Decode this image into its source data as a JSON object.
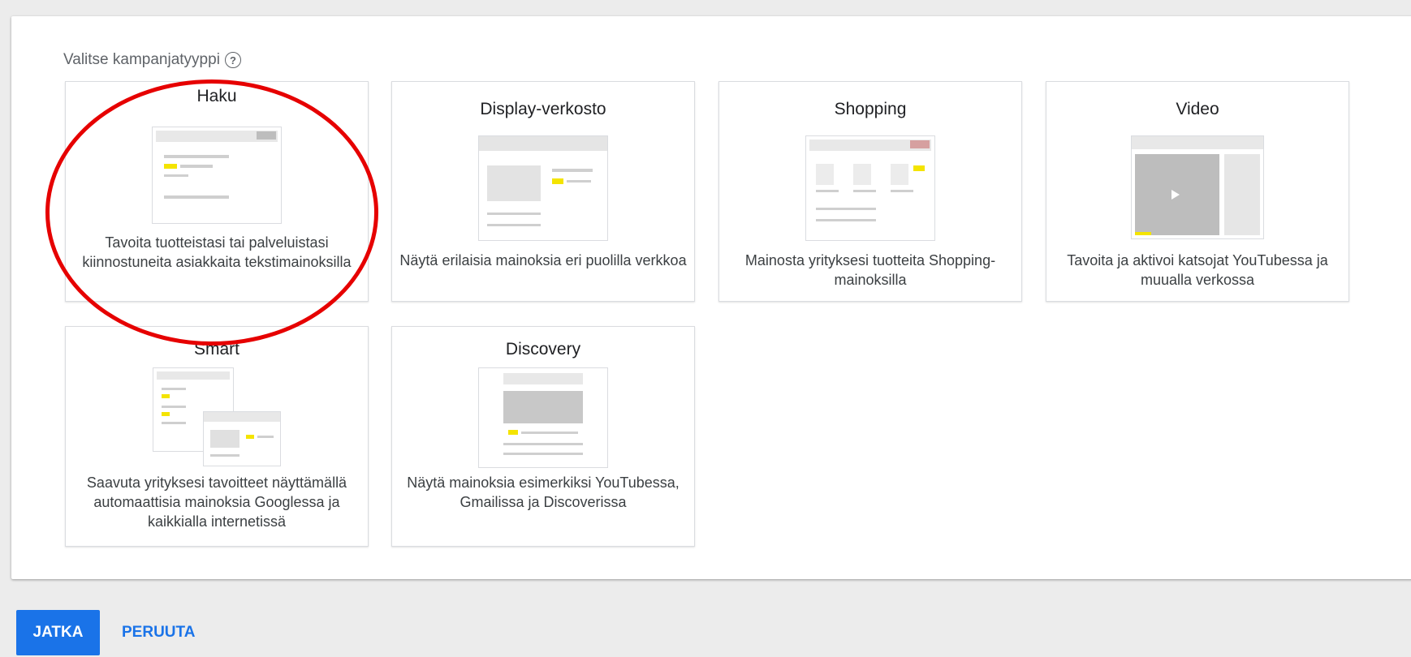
{
  "form": {
    "prompt": "Valitse kampanjatyyppi",
    "help_icon": "help-circle-icon"
  },
  "campaign_types": [
    {
      "title": "Haku",
      "description": "Tavoita tuotteistasi tai palveluistasi kiinnostuneita asiakkaita tekstimainoksilla",
      "selected_highlight": true
    },
    {
      "title": "Display-verkosto",
      "description": "Näytä erilaisia mainoksia eri puolilla verkkoa"
    },
    {
      "title": "Shopping",
      "description": "Mainosta yrityksesi tuotteita Shopping-mainoksilla"
    },
    {
      "title": "Video",
      "description": "Tavoita ja aktivoi katsojat YouTubessa ja muualla verkossa"
    },
    {
      "title": "Smart",
      "description": "Saavuta yrityksesi tavoitteet näyttämällä automaattisia mainoksia Googlessa ja kaikkialla internetissä"
    },
    {
      "title": "Discovery",
      "description": "Näytä mainoksia esimerkiksi YouTubessa, Gmailissa ja Discoverissa"
    }
  ],
  "actions": {
    "continue_label": "JATKA",
    "cancel_label": "PERUUTA"
  },
  "colors": {
    "accent": "#1a73e8",
    "highlight_ring": "#e60000",
    "thumbnail_yellow": "#f4e400"
  }
}
